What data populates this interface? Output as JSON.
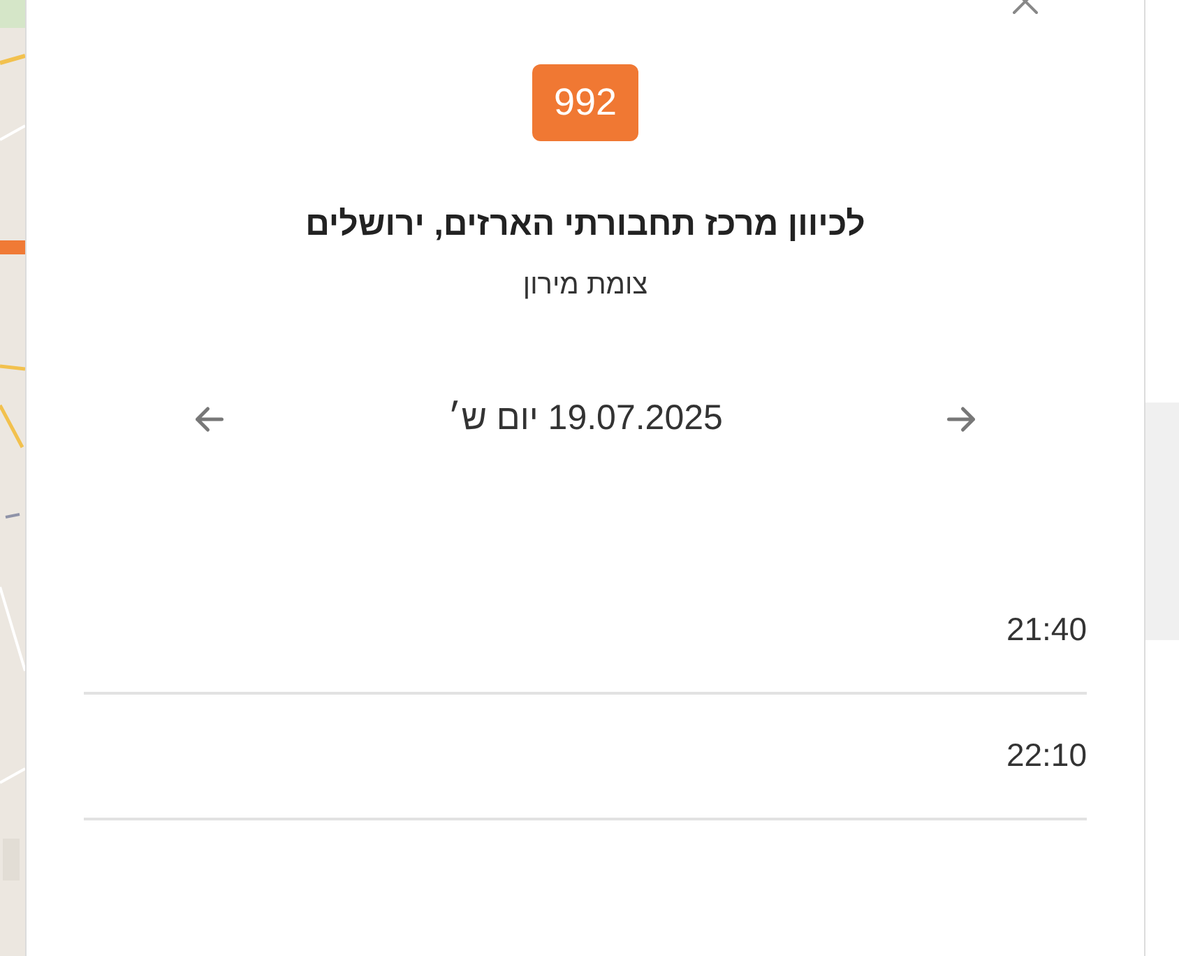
{
  "badge": "992",
  "title": "לכיוון מרכז תחבורתי הארזים, ירושלים",
  "subtitle": "צומת מירון",
  "date": "19.07.2025 יום ש׳",
  "departures": [
    {
      "time": "21:40"
    },
    {
      "time": "22:10"
    }
  ]
}
